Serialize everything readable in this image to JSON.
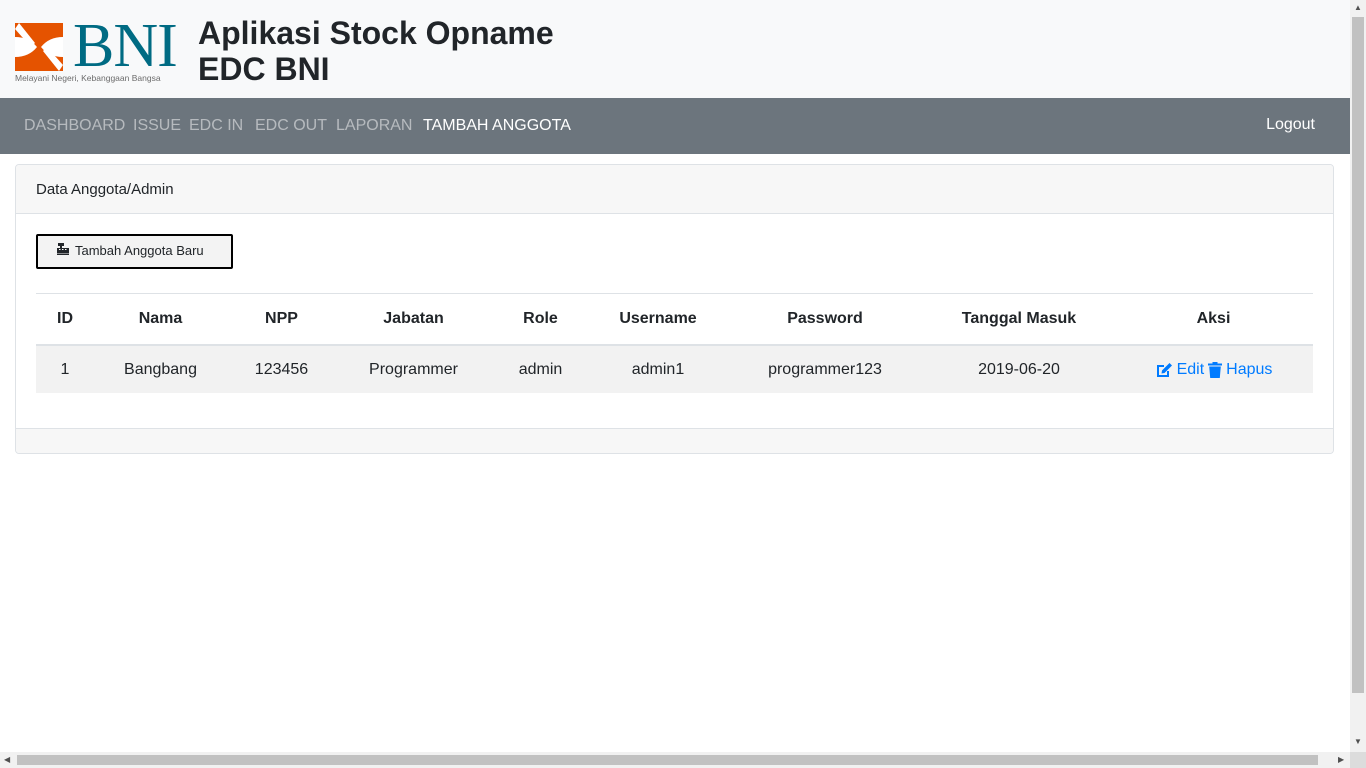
{
  "brand": {
    "logo_text": "BNI",
    "tagline": "Melayani Negeri, Kebanggaan Bangsa",
    "title_line1": "Aplikasi Stock Opname",
    "title_line2": "EDC BNI",
    "colors": {
      "logo_orange": "#e55300",
      "logo_teal": "#006b83"
    }
  },
  "nav": {
    "items": [
      {
        "label": "DASHBOARD"
      },
      {
        "label": "ISSUE"
      },
      {
        "label": "EDC IN"
      },
      {
        "label": "EDC OUT"
      },
      {
        "label": "LAPORAN"
      },
      {
        "label": "TAMBAH ANGGOTA",
        "active": true
      }
    ],
    "logout": "Logout",
    "bg_color": "#6c757d"
  },
  "card": {
    "title": "Data Anggota/Admin",
    "add_button": {
      "label": "Tambah Anggota Baru",
      "icon": "cash-register-icon"
    }
  },
  "table": {
    "headers": [
      "ID",
      "Nama",
      "NPP",
      "Jabatan",
      "Role",
      "Username",
      "Password",
      "Tanggal Masuk",
      "Aksi"
    ],
    "rows": [
      {
        "id": "1",
        "nama": "Bangbang",
        "npp": "123456",
        "jabatan": "Programmer",
        "role": "admin",
        "username": "admin1",
        "password": "programmer123",
        "tanggal_masuk": "2019-06-20",
        "edit_label": "Edit",
        "hapus_label": "Hapus"
      }
    ],
    "link_color": "#007bff"
  }
}
